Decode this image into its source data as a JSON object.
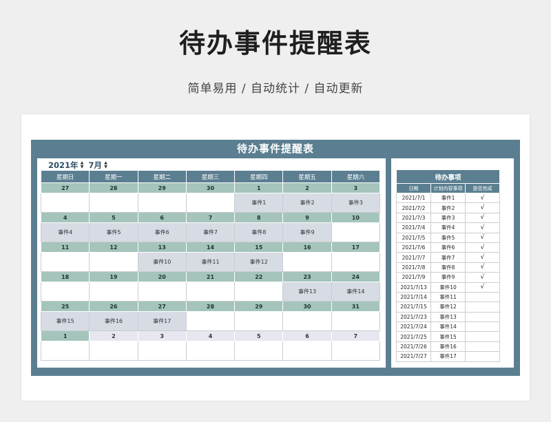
{
  "header": {
    "title": "待办事件提醒表",
    "subtitle": "简单易用 / 自动统计 / 自动更新"
  },
  "sheet": {
    "title": "待办事件提醒表",
    "year_label": "2021年",
    "month_label": "7月",
    "weekdays": [
      "星期日",
      "星期一",
      "星期二",
      "星期三",
      "星期四",
      "星期五",
      "星期六"
    ],
    "weeks": [
      {
        "dates": [
          "27",
          "28",
          "29",
          "30",
          "1",
          "2",
          "3"
        ],
        "events": [
          "",
          "",
          "",
          "",
          "事件1",
          "事件2",
          "事件3"
        ]
      },
      {
        "dates": [
          "4",
          "5",
          "6",
          "7",
          "8",
          "9",
          "10"
        ],
        "events": [
          "事件4",
          "事件5",
          "事件6",
          "事件7",
          "事件8",
          "事件9",
          ""
        ]
      },
      {
        "dates": [
          "11",
          "12",
          "13",
          "14",
          "15",
          "16",
          "17"
        ],
        "events": [
          "",
          "",
          "事件10",
          "事件11",
          "事件12",
          "",
          ""
        ]
      },
      {
        "dates": [
          "18",
          "19",
          "20",
          "21",
          "22",
          "23",
          "24"
        ],
        "events": [
          "",
          "",
          "",
          "",
          "",
          "事件13",
          "事件14"
        ]
      },
      {
        "dates": [
          "25",
          "26",
          "27",
          "28",
          "29",
          "30",
          "31"
        ],
        "events": [
          "事件15",
          "事件16",
          "事件17",
          "",
          "",
          "",
          ""
        ]
      },
      {
        "dates": [
          "1",
          "2",
          "3",
          "4",
          "5",
          "6",
          "7"
        ],
        "events": [
          "",
          "",
          "",
          "",
          "",
          "",
          ""
        ]
      }
    ]
  },
  "todo": {
    "title": "待办事项",
    "columns": [
      "日期",
      "计划内容事项",
      "是否完成"
    ],
    "rows": [
      {
        "date": "2021/7/1",
        "item": "事件1",
        "done": "√"
      },
      {
        "date": "2021/7/2",
        "item": "事件2",
        "done": "√"
      },
      {
        "date": "2021/7/3",
        "item": "事件3",
        "done": "√"
      },
      {
        "date": "2021/7/4",
        "item": "事件4",
        "done": "√"
      },
      {
        "date": "2021/7/5",
        "item": "事件5",
        "done": "√"
      },
      {
        "date": "2021/7/6",
        "item": "事件6",
        "done": "√"
      },
      {
        "date": "2021/7/7",
        "item": "事件7",
        "done": "√"
      },
      {
        "date": "2021/7/8",
        "item": "事件8",
        "done": "√"
      },
      {
        "date": "2021/7/9",
        "item": "事件9",
        "done": "√"
      },
      {
        "date": "2021/7/13",
        "item": "事件10",
        "done": "√"
      },
      {
        "date": "2021/7/14",
        "item": "事件11",
        "done": ""
      },
      {
        "date": "2021/7/15",
        "item": "事件12",
        "done": ""
      },
      {
        "date": "2021/7/23",
        "item": "事件13",
        "done": ""
      },
      {
        "date": "2021/7/24",
        "item": "事件14",
        "done": ""
      },
      {
        "date": "2021/7/25",
        "item": "事件15",
        "done": ""
      },
      {
        "date": "2021/7/26",
        "item": "事件16",
        "done": ""
      },
      {
        "date": "2021/7/27",
        "item": "事件17",
        "done": ""
      }
    ]
  },
  "colors": {
    "frame": "#5b7f91",
    "date_row": "#a4c4bc",
    "event_fill": "#d7dbe4",
    "next_month_row": "#e6e7f0"
  }
}
